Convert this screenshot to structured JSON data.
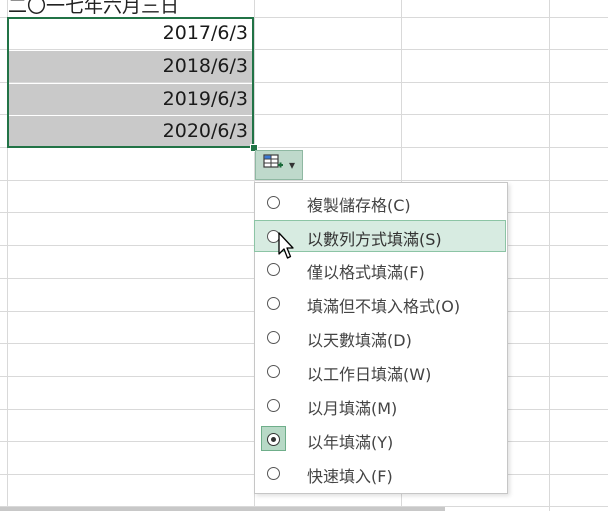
{
  "sheet": {
    "header_cell": "二〇一七年六月三日",
    "dates": [
      {
        "text": "2017/6/3",
        "selected": false
      },
      {
        "text": "2018/6/3",
        "selected": true
      },
      {
        "text": "2019/6/3",
        "selected": true
      },
      {
        "text": "2020/6/3",
        "selected": true
      }
    ]
  },
  "autofill": {
    "icon": "autofill-options-icon",
    "arrow": "▾"
  },
  "menu": {
    "items": [
      {
        "label": "複製儲存格(C)",
        "state": "normal"
      },
      {
        "label": "以數列方式填滿(S)",
        "state": "hover"
      },
      {
        "label": "僅以格式填滿(F)",
        "state": "normal"
      },
      {
        "label": "填滿但不填入格式(O)",
        "state": "normal"
      },
      {
        "label": "以天數填滿(D)",
        "state": "normal"
      },
      {
        "label": "以工作日填滿(W)",
        "state": "normal"
      },
      {
        "label": "以月填滿(M)",
        "state": "normal"
      },
      {
        "label": "以年填滿(Y)",
        "state": "checked"
      },
      {
        "label": "快速填入(F)",
        "state": "normal"
      }
    ]
  },
  "colors": {
    "selection_border": "#217346",
    "selected_fill": "#c9c9c9",
    "hover_fill": "#d7ebe1"
  }
}
